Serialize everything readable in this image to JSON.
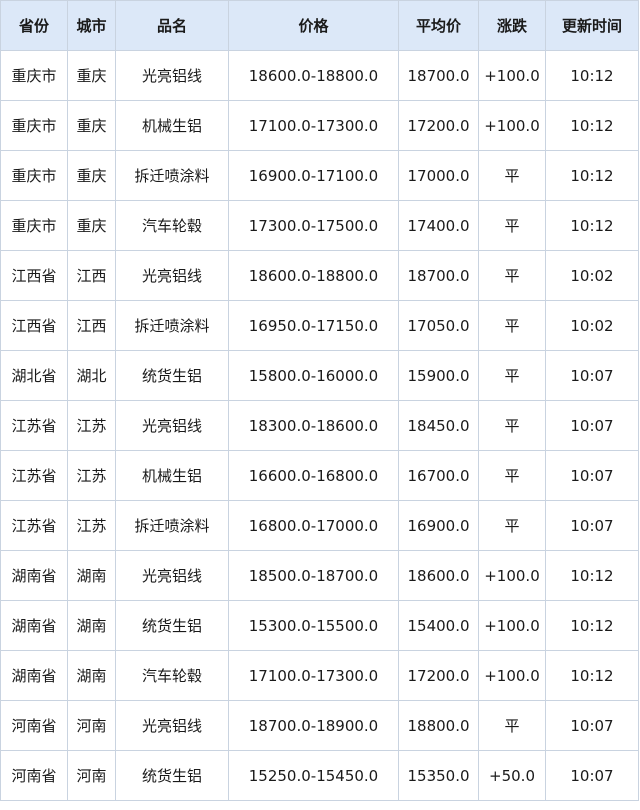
{
  "table": {
    "headers": [
      "省份",
      "城市",
      "品名",
      "价格",
      "平均价",
      "涨跌",
      "更新时间"
    ],
    "rows": [
      [
        "重庆市",
        "重庆",
        "光亮铝线",
        "18600.0-18800.0",
        "18700.0",
        "+100.0",
        "10:12"
      ],
      [
        "重庆市",
        "重庆",
        "机械生铝",
        "17100.0-17300.0",
        "17200.0",
        "+100.0",
        "10:12"
      ],
      [
        "重庆市",
        "重庆",
        "拆迁喷涂料",
        "16900.0-17100.0",
        "17000.0",
        "平",
        "10:12"
      ],
      [
        "重庆市",
        "重庆",
        "汽车轮毂",
        "17300.0-17500.0",
        "17400.0",
        "平",
        "10:12"
      ],
      [
        "江西省",
        "江西",
        "光亮铝线",
        "18600.0-18800.0",
        "18700.0",
        "平",
        "10:02"
      ],
      [
        "江西省",
        "江西",
        "拆迁喷涂料",
        "16950.0-17150.0",
        "17050.0",
        "平",
        "10:02"
      ],
      [
        "湖北省",
        "湖北",
        "统货生铝",
        "15800.0-16000.0",
        "15900.0",
        "平",
        "10:07"
      ],
      [
        "江苏省",
        "江苏",
        "光亮铝线",
        "18300.0-18600.0",
        "18450.0",
        "平",
        "10:07"
      ],
      [
        "江苏省",
        "江苏",
        "机械生铝",
        "16600.0-16800.0",
        "16700.0",
        "平",
        "10:07"
      ],
      [
        "江苏省",
        "江苏",
        "拆迁喷涂料",
        "16800.0-17000.0",
        "16900.0",
        "平",
        "10:07"
      ],
      [
        "湖南省",
        "湖南",
        "光亮铝线",
        "18500.0-18700.0",
        "18600.0",
        "+100.0",
        "10:12"
      ],
      [
        "湖南省",
        "湖南",
        "统货生铝",
        "15300.0-15500.0",
        "15400.0",
        "+100.0",
        "10:12"
      ],
      [
        "湖南省",
        "湖南",
        "汽车轮毂",
        "17100.0-17300.0",
        "17200.0",
        "+100.0",
        "10:12"
      ],
      [
        "河南省",
        "河南",
        "光亮铝线",
        "18700.0-18900.0",
        "18800.0",
        "平",
        "10:07"
      ],
      [
        "河南省",
        "河南",
        "统货生铝",
        "15250.0-15450.0",
        "15350.0",
        "+50.0",
        "10:07"
      ]
    ]
  },
  "colors": {
    "header_bg": "#dce8f8",
    "border": "#c9d3e0",
    "text": "#1a1a1a",
    "up": "#e02020"
  }
}
